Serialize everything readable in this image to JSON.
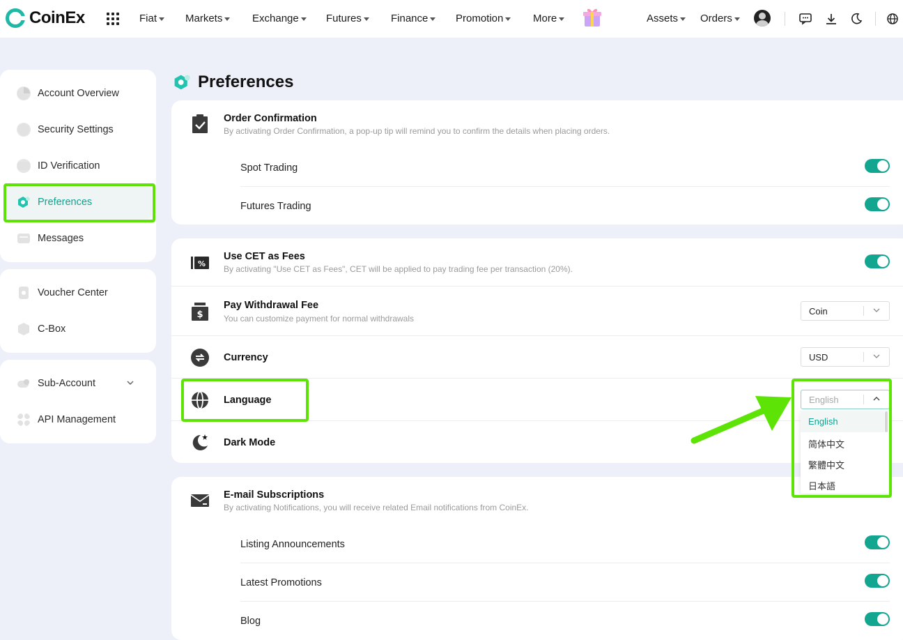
{
  "brand": {
    "name": "CoinEx",
    "accent": "#12a590",
    "highlight": "#5ee307"
  },
  "nav": {
    "items": [
      "Fiat",
      "Markets",
      "Exchange",
      "Futures",
      "Finance",
      "Promotion",
      "More"
    ],
    "right": [
      "Assets",
      "Orders"
    ]
  },
  "sidebar": {
    "group1": [
      "Account Overview",
      "Security Settings",
      "ID Verification",
      "Preferences",
      "Messages"
    ],
    "group2": [
      "Voucher Center",
      "C-Box"
    ],
    "group3": [
      "Sub-Account",
      "API Management"
    ],
    "active": "Preferences"
  },
  "page": {
    "title": "Preferences"
  },
  "order_confirmation": {
    "title": "Order Confirmation",
    "desc": "By activating Order Confirmation, a pop-up tip will remind you to confirm the details when placing orders.",
    "spot": "Spot Trading",
    "futures": "Futures Trading"
  },
  "cet_fees": {
    "title": "Use CET as Fees",
    "desc": "By activating \"Use CET as Fees\", CET will be applied to pay trading fee per transaction (20%)."
  },
  "withdrawal_fee": {
    "title": "Pay Withdrawal Fee",
    "desc": "You can customize payment for normal withdrawals",
    "value": "Coin"
  },
  "currency": {
    "title": "Currency",
    "value": "USD"
  },
  "language": {
    "title": "Language",
    "value": "English",
    "options": [
      "English",
      "简体中文",
      "繁體中文",
      "日本語"
    ]
  },
  "dark_mode": {
    "title": "Dark Mode"
  },
  "email": {
    "title": "E-mail Subscriptions",
    "desc": "By activating Notifications, you will receive related Email notifications from CoinEx.",
    "items": [
      "Listing Announcements",
      "Latest Promotions",
      "Blog"
    ]
  }
}
